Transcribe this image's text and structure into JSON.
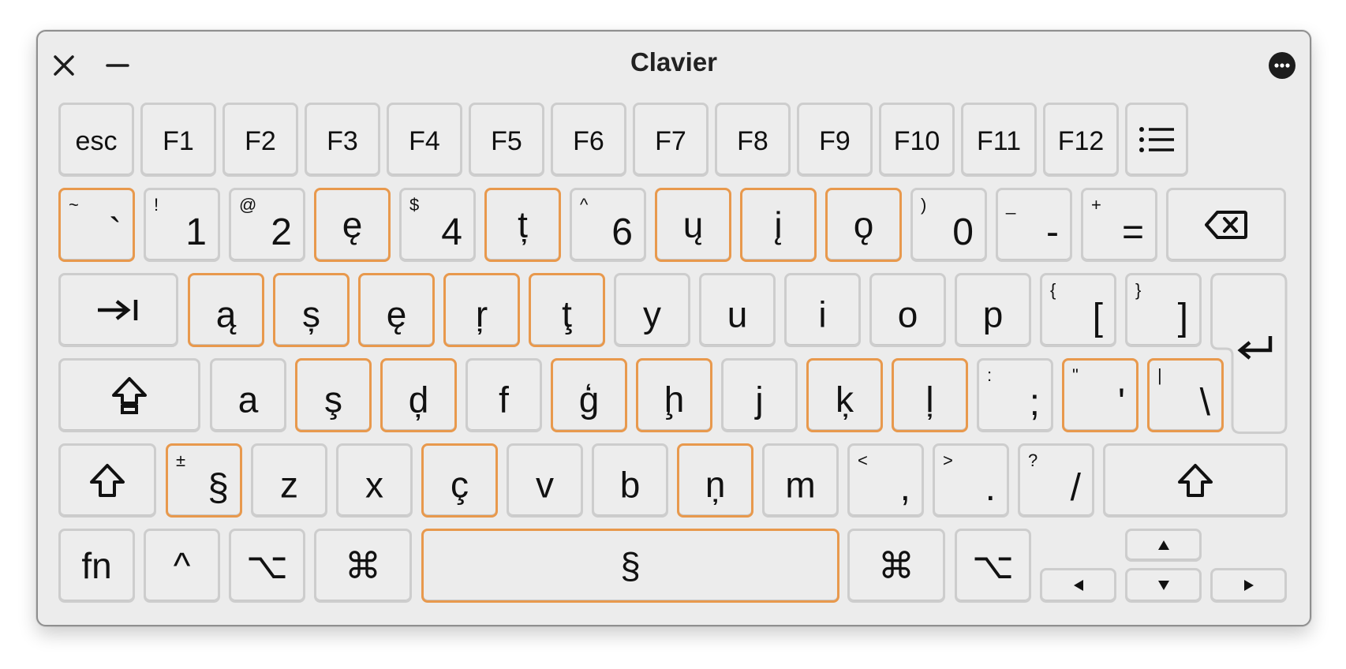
{
  "window": {
    "title": "Clavier"
  },
  "keys": {
    "esc": "esc",
    "f1": "F1",
    "f2": "F2",
    "f3": "F3",
    "f4": "F4",
    "f5": "F5",
    "f6": "F6",
    "f7": "F7",
    "f8": "F8",
    "f9": "F9",
    "f10": "F10",
    "f11": "F11",
    "f12": "F12",
    "grave": {
      "top": "~",
      "main": "`"
    },
    "n1": {
      "top": "!",
      "main": "1"
    },
    "n2": {
      "top": "@",
      "main": "2"
    },
    "n3": {
      "main": "ę"
    },
    "n4": {
      "top": "$",
      "main": "4"
    },
    "n5": {
      "main": "ț"
    },
    "n6": {
      "top": "^",
      "main": "6"
    },
    "n7": {
      "main": "ų"
    },
    "n8": {
      "main": "į"
    },
    "n9": {
      "main": "ǫ"
    },
    "n0": {
      "top": ")",
      "main": "0"
    },
    "minus": {
      "top": "_",
      "main": "-"
    },
    "equal": {
      "top": "+",
      "main": "="
    },
    "q": "ą",
    "w": "ș",
    "e": "ę",
    "r": "ŗ",
    "t": "ţ",
    "y": "y",
    "u": "u",
    "i": "i",
    "o": "o",
    "p": "p",
    "lbracket": {
      "top": "{",
      "main": "["
    },
    "rbracket": {
      "top": "}",
      "main": "]"
    },
    "a": "a",
    "s": "ş",
    "d": "ḑ",
    "f": "f",
    "g": "ģ",
    "h": "ḩ",
    "j": "j",
    "k": "ķ",
    "l": "ļ",
    "semicolon": {
      "top": ":",
      "main": ";"
    },
    "quote": {
      "top": "\"",
      "main": "'"
    },
    "backslash": {
      "top": "|",
      "main": "\\"
    },
    "section": {
      "top": "±",
      "main": "§"
    },
    "z": "z",
    "x": "x",
    "c": "ç",
    "v": "v",
    "b": "b",
    "n": "ņ",
    "m": "m",
    "comma": {
      "top": "<",
      "main": ","
    },
    "period": {
      "top": ">",
      "main": "."
    },
    "slash": {
      "top": "?",
      "main": "/"
    },
    "fn": "fn",
    "control": "^",
    "option": "⌥",
    "command": "⌘",
    "space": "§"
  },
  "colors": {
    "highlight": "#e8994d",
    "key_border": "#cdcdcd",
    "window_bg": "#ececec"
  },
  "icons": [
    "close-icon",
    "minimize-icon",
    "more-icon",
    "list-icon",
    "delete-icon",
    "tab-icon",
    "return-icon",
    "caps-lock-icon",
    "shift-icon",
    "arrow-up-icon",
    "arrow-down-icon",
    "arrow-left-icon",
    "arrow-right-icon"
  ]
}
